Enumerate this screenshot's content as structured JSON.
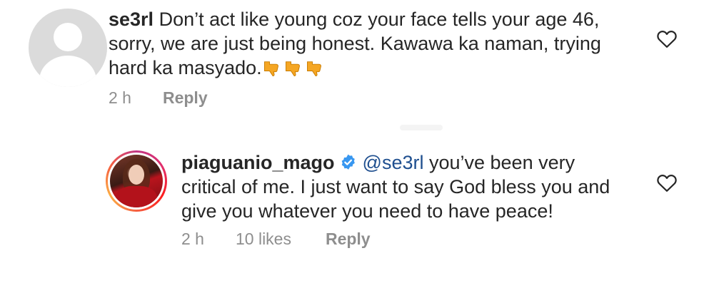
{
  "comments": [
    {
      "username": "se3rl",
      "text_line1": "Don’t act like young coz your face tells your age 46,",
      "text_line2": "sorry, we are just being honest. Kawawa ka naman, trying",
      "text_line3": "hard ka masyado.",
      "emoji": "thumbs-down x3",
      "time": "2 h",
      "reply": "Reply",
      "heart_icon": "heart-outline-icon"
    },
    {
      "username": "piaguanio_mago",
      "verified": true,
      "mention": "@se3rl",
      "text_line1": " you’ve been very",
      "text_line2": "critical of me. I just want to say God bless you and",
      "text_line3": "give you whatever you need to have peace!",
      "time": "2 h",
      "likes": "10 likes",
      "reply": "Reply",
      "heart_icon": "heart-outline-icon"
    }
  ],
  "colors": {
    "text": "#262626",
    "meta": "#8e8e8e",
    "mention": "#1f4f8f",
    "verified": "#3897f0",
    "thumb": "#f5a623"
  }
}
